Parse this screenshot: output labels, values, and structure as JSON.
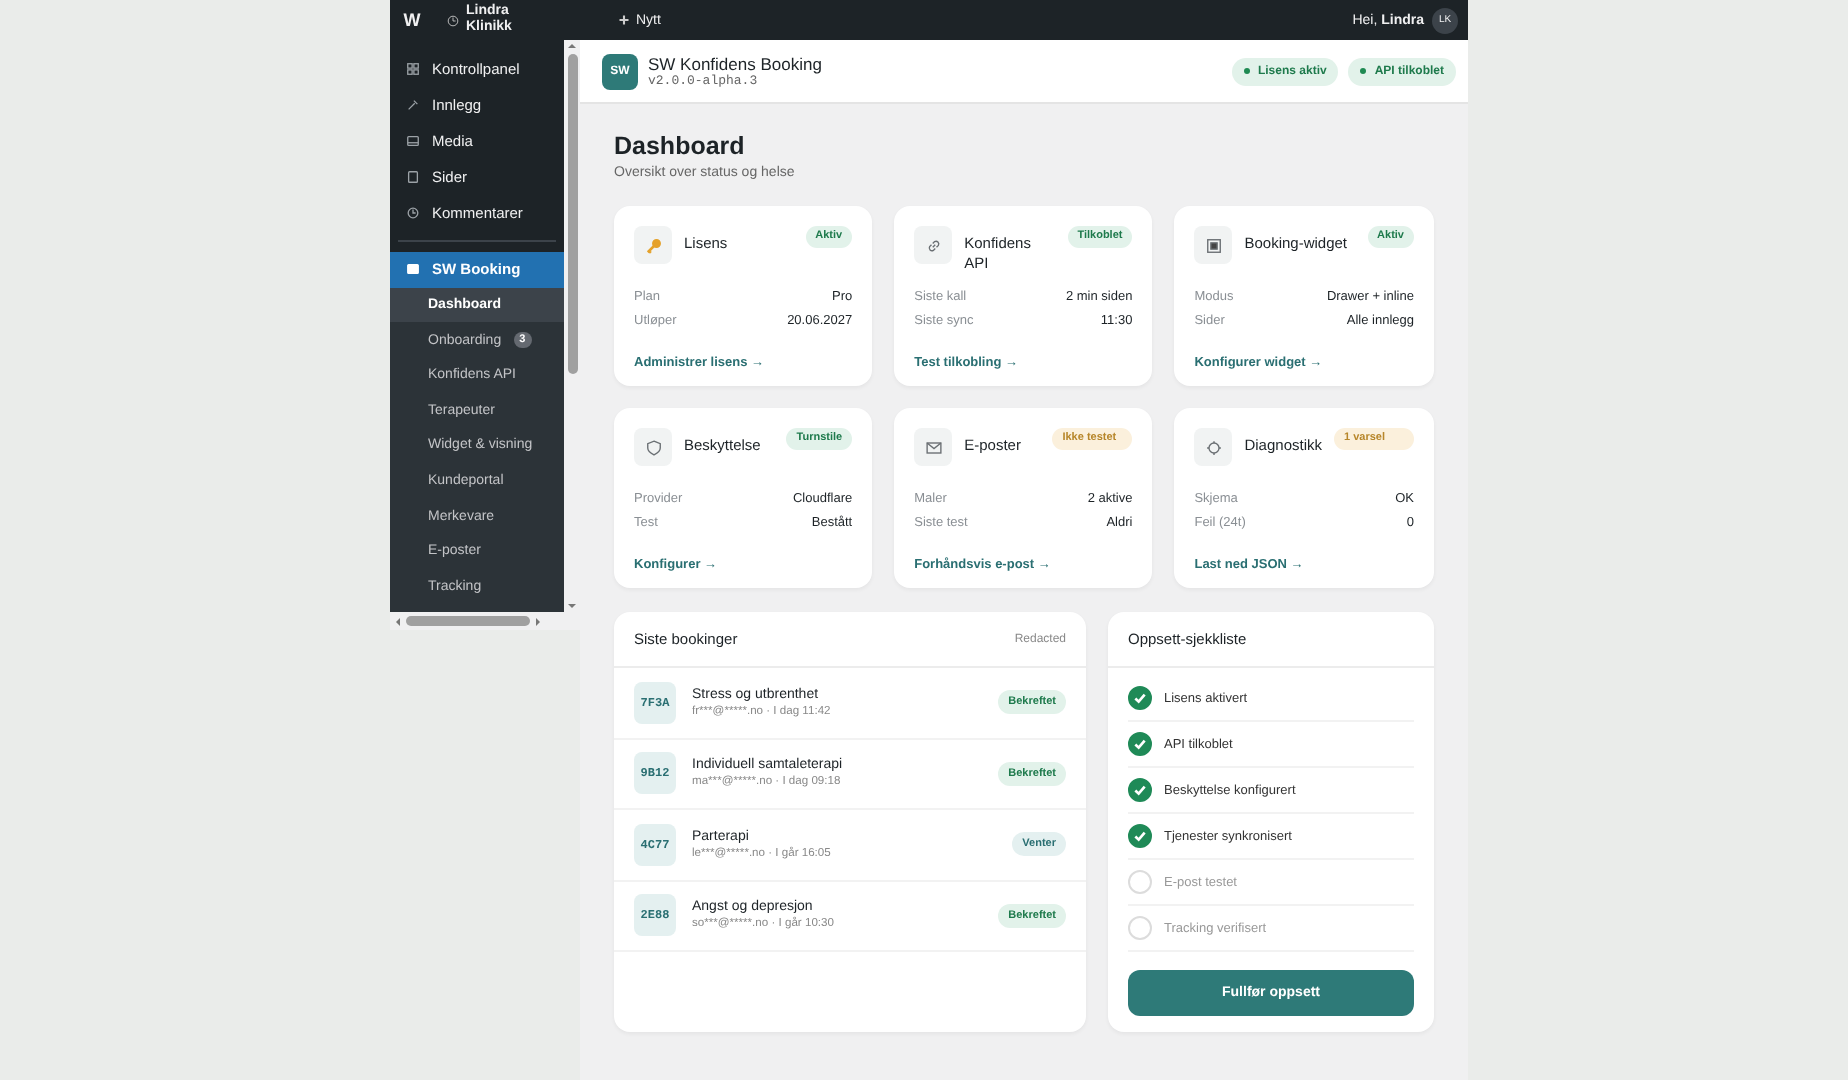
{
  "admin_bar": {
    "logo": "W",
    "site_name": "Lindra Klinikk",
    "new_label": "Nytt",
    "greeting": "Hei, **Lindra**",
    "avatar_initials": "LK"
  },
  "sidebar": {
    "items": [
      {
        "label": "Kontrollpanel",
        "selected": false
      },
      {
        "label": "Innlegg",
        "selected": false
      },
      {
        "label": "Media",
        "selected": false
      },
      {
        "label": "Sider",
        "selected": false
      },
      {
        "label": "Kommentarer",
        "selected": false
      },
      {
        "label": "SW Booking",
        "selected": true
      }
    ],
    "submenu": [
      {
        "label": "Dashboard",
        "selected": true
      },
      {
        "label": "Onboarding",
        "selected": false,
        "badge": "3"
      },
      {
        "label": "Konfidens API",
        "selected": false
      },
      {
        "label": "Terapeuter",
        "selected": false
      },
      {
        "label": "Widget & visning",
        "selected": false
      },
      {
        "label": "Kundeportal",
        "selected": false
      },
      {
        "label": "Merkevare",
        "selected": false
      },
      {
        "label": "E-poster",
        "selected": false
      },
      {
        "label": "Tracking",
        "selected": false
      }
    ]
  },
  "plugin_header": {
    "logo": "SW",
    "title": "SW Konfidens Booking",
    "version": "v2.0.0-alpha.3",
    "pills": [
      "Lisens aktiv",
      "API tilkoblet"
    ]
  },
  "page": {
    "title": "Dashboard",
    "subtitle": "Oversikt over status og helse"
  },
  "cards": [
    {
      "title": "Lisens",
      "badge": {
        "label": "Aktiv",
        "kind": "success"
      },
      "rows": [
        [
          "Plan",
          "Pro"
        ],
        [
          "Utløper",
          "20.06.2027"
        ]
      ],
      "link": "Administrer lisens →"
    },
    {
      "title": "Konfidens API",
      "badge": {
        "label": "Tilkoblet",
        "kind": "success"
      },
      "rows": [
        [
          "Siste kall",
          "2 min siden"
        ],
        [
          "Siste sync",
          "11:30"
        ]
      ],
      "link": "Test tilkobling →"
    },
    {
      "title": "Booking-widget",
      "badge": {
        "label": "Aktiv",
        "kind": "success"
      },
      "rows": [
        [
          "Modus",
          "Drawer + inline"
        ],
        [
          "Sider",
          "Alle innlegg"
        ]
      ],
      "link": "Konfigurer widget →"
    },
    {
      "title": "Beskyttelse",
      "badge": {
        "label": "Turnstile",
        "kind": "success"
      },
      "rows": [
        [
          "Provider",
          "Cloudflare"
        ],
        [
          "Test",
          "Bestått"
        ]
      ],
      "link": "Konfigurer →"
    },
    {
      "title": "E-poster",
      "badge": {
        "label": "Ikke testet",
        "kind": "warning"
      },
      "rows": [
        [
          "Maler",
          "2 aktive"
        ],
        [
          "Siste test",
          "Aldri"
        ]
      ],
      "link": "Forhåndsvis e-post →"
    },
    {
      "title": "Diagnostikk",
      "badge": {
        "label": "1 varsel",
        "kind": "warning"
      },
      "rows": [
        [
          "Skjema",
          "OK"
        ],
        [
          "Feil (24t)",
          "0"
        ]
      ],
      "link": "Last ned JSON →"
    }
  ],
  "bookings": {
    "title": "Siste bookinger",
    "note": "Redacted",
    "rows": [
      {
        "code": "7F3A",
        "service": "Stress og utbrenthet",
        "meta": "fr***@*****.no · I dag 11:42",
        "status": {
          "label": "Bekreftet",
          "kind": "confirmed"
        }
      },
      {
        "code": "9B12",
        "service": "Individuell samtaleterapi",
        "meta": "ma***@*****.no · I dag 09:18",
        "status": {
          "label": "Bekreftet",
          "kind": "confirmed"
        }
      },
      {
        "code": "4C77",
        "service": "Parterapi",
        "meta": "le***@*****.no · I går 16:05",
        "status": {
          "label": "Venter",
          "kind": "pending"
        }
      },
      {
        "code": "2E88",
        "service": "Angst og depresjon",
        "meta": "so***@*****.no · I går 10:30",
        "status": {
          "label": "Bekreftet",
          "kind": "confirmed"
        }
      }
    ]
  },
  "checklist": {
    "title": "Oppsett-sjekkliste",
    "items": [
      {
        "label": "Lisens aktivert",
        "checked": true
      },
      {
        "label": "API tilkoblet",
        "checked": true
      },
      {
        "label": "Beskyttelse konfigurert",
        "checked": true
      },
      {
        "label": "Tjenester synkronisert",
        "checked": true
      },
      {
        "label": "E-post testet",
        "checked": false
      },
      {
        "label": "Tracking verifisert",
        "checked": false
      }
    ],
    "button": "Fullfør oppsett"
  }
}
